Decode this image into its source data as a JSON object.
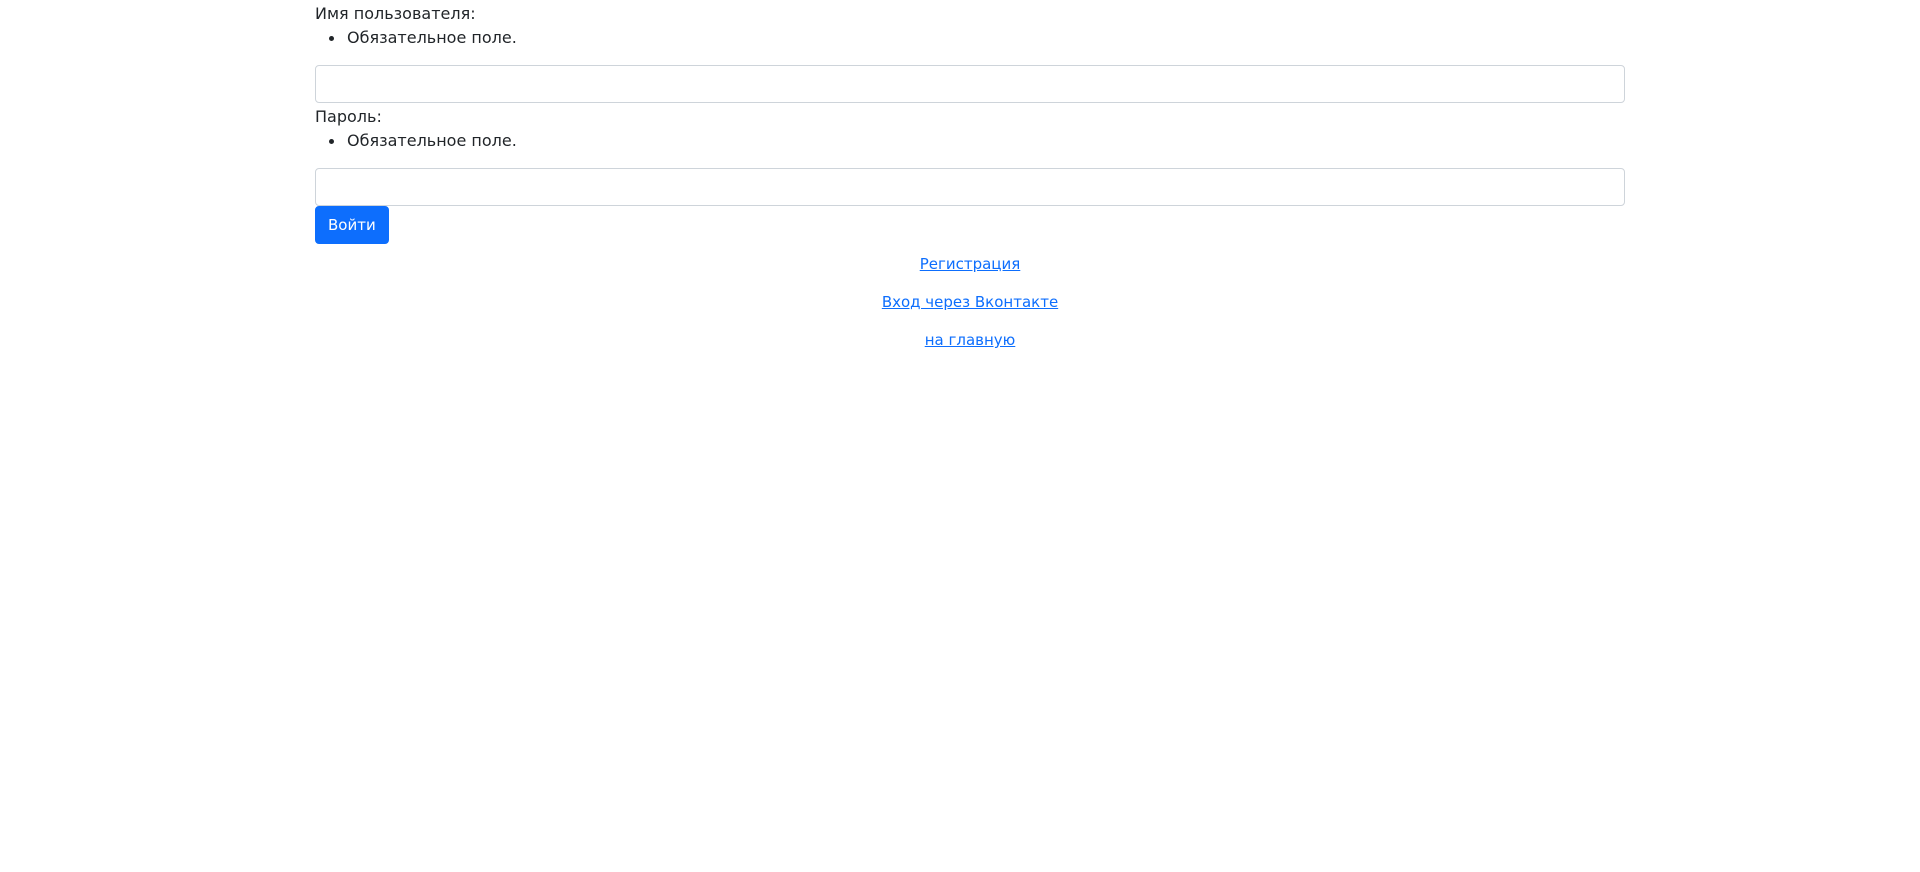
{
  "login_form": {
    "username": {
      "label": "Имя пользователя:",
      "error": "Обязательное поле.",
      "value": "",
      "placeholder": ""
    },
    "password": {
      "label": "Пароль:",
      "error": "Обязательное поле.",
      "value": "",
      "placeholder": ""
    },
    "submit_label": "Войти"
  },
  "links": {
    "register": "Регистрация",
    "vk_login": "Вход через Вконтакте",
    "home": "на главную"
  },
  "colors": {
    "accent": "#0d6efd",
    "text": "#212529",
    "input_border": "#ced4da"
  }
}
